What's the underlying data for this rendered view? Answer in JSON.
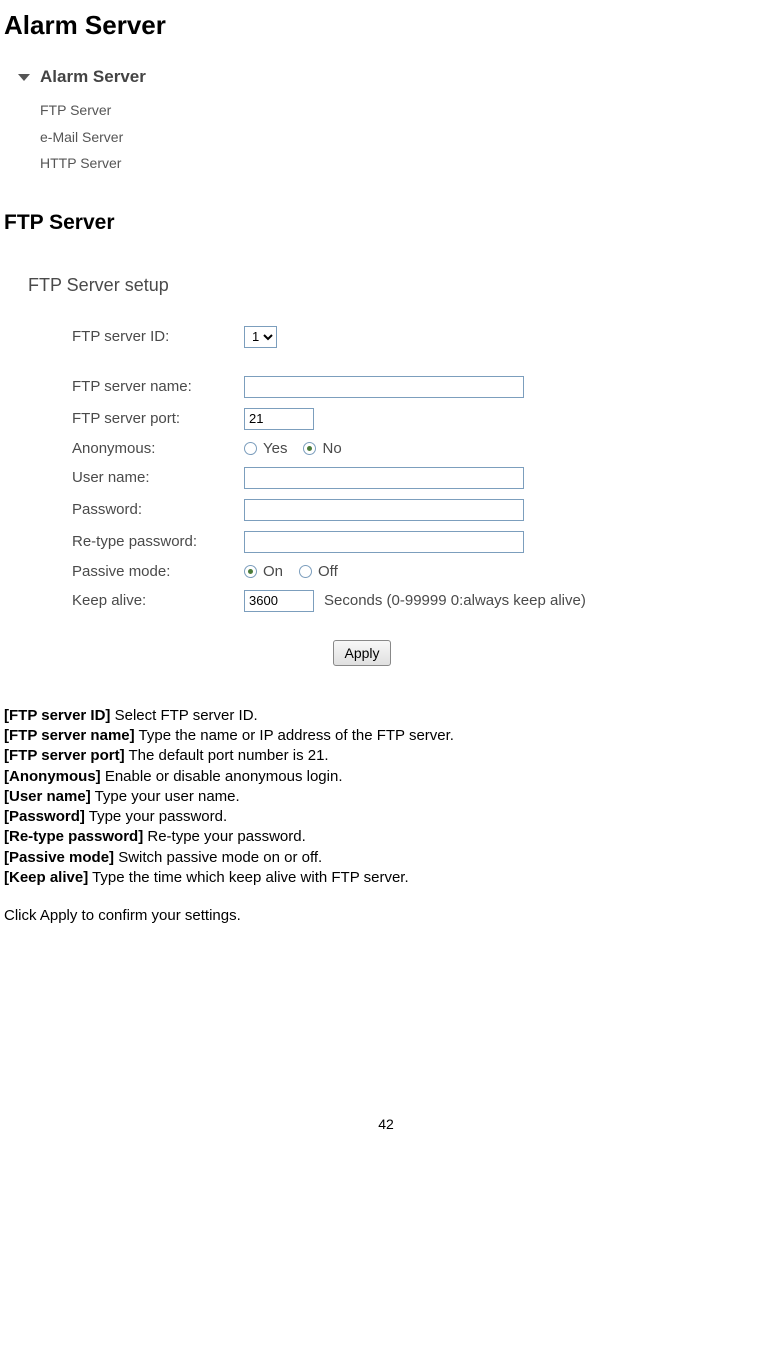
{
  "headings": {
    "main": "Alarm Server",
    "sub": "FTP Server",
    "setup": "FTP Server setup"
  },
  "nav": {
    "title": "Alarm Server",
    "items": [
      "FTP Server",
      "e-Mail Server",
      "HTTP Server"
    ]
  },
  "form": {
    "server_id": {
      "label": "FTP server ID:",
      "value": "1"
    },
    "server_name": {
      "label": "FTP server name:",
      "value": ""
    },
    "server_port": {
      "label": "FTP server port:",
      "value": "21"
    },
    "anonymous": {
      "label": "Anonymous:",
      "yes": "Yes",
      "no": "No",
      "selected": "no"
    },
    "user_name": {
      "label": "User name:",
      "value": ""
    },
    "password": {
      "label": "Password:",
      "value": ""
    },
    "retype": {
      "label": "Re-type password:",
      "value": ""
    },
    "passive": {
      "label": "Passive mode:",
      "on": "On",
      "off": "Off",
      "selected": "on"
    },
    "keep_alive": {
      "label": "Keep alive:",
      "value": "3600",
      "suffix": "Seconds (0-99999 0:always keep alive)"
    },
    "apply": "Apply"
  },
  "descriptions": [
    {
      "key": "[FTP server ID]",
      "text": " Select FTP server ID."
    },
    {
      "key": "[FTP server name]",
      "text": " Type the name or IP address of the FTP server."
    },
    {
      "key": "[FTP server port]",
      "text": " The default port number is 21."
    },
    {
      "key": "[Anonymous]",
      "text": " Enable or disable anonymous login."
    },
    {
      "key": "[User name]",
      "text": " Type your user name."
    },
    {
      "key": "[Password]",
      "text": " Type your password."
    },
    {
      "key": "[Re-type password]",
      "text": " Re-type your password."
    },
    {
      "key": "[Passive mode]",
      "text": " Switch passive mode on or off."
    },
    {
      "key": "[Keep alive]",
      "text": " Type the time which keep alive with FTP server."
    }
  ],
  "click_line": {
    "prefix": "Click ",
    "bold": "Apply",
    "suffix": " to confirm your settings."
  },
  "page_number": "42"
}
